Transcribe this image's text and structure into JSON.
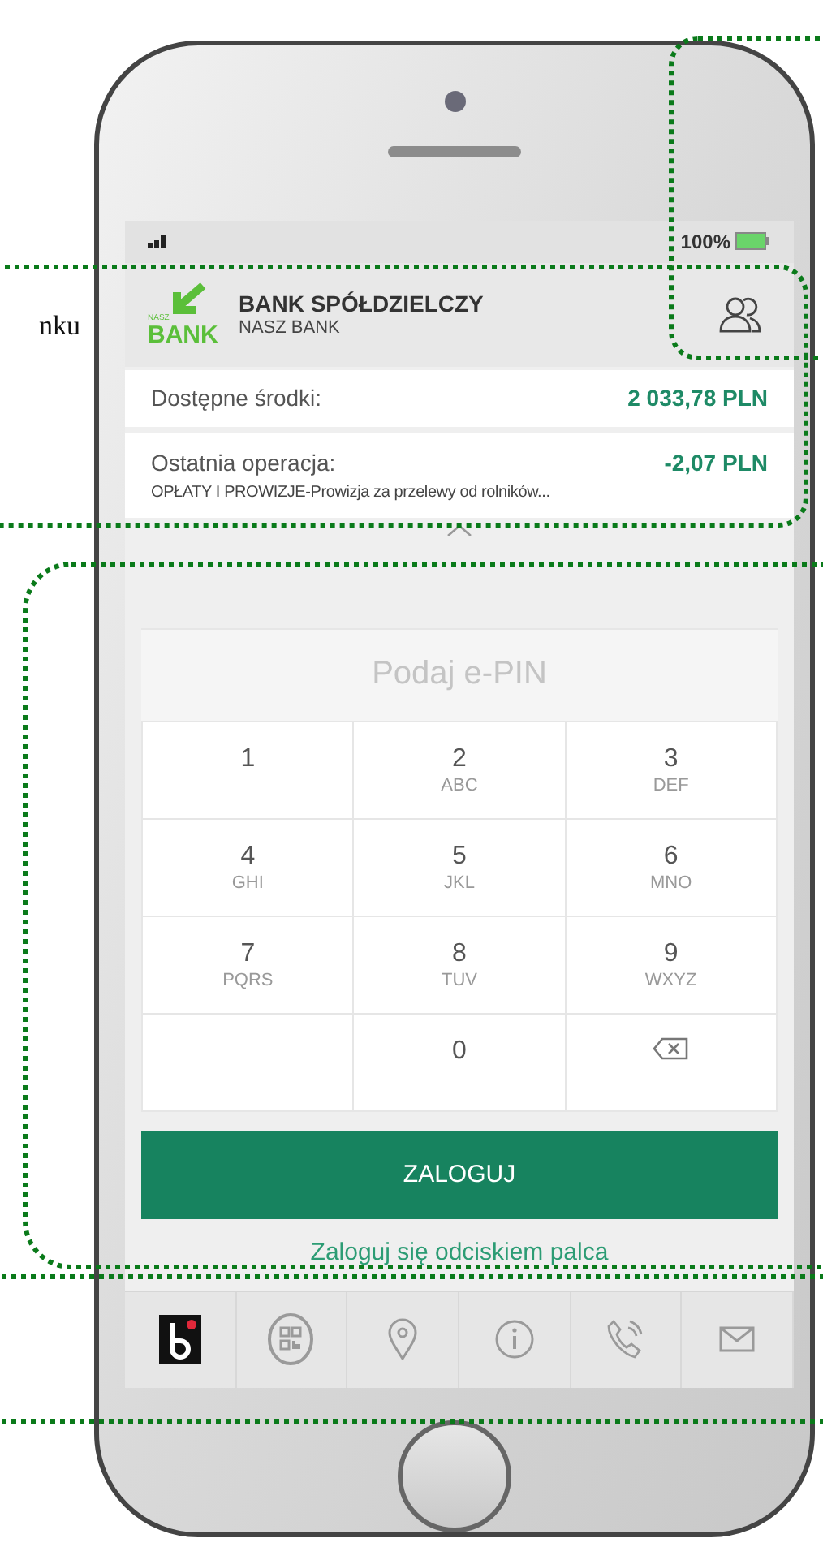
{
  "annotation": {
    "text": "nku"
  },
  "status_bar": {
    "battery": "100%"
  },
  "header": {
    "logo_small": "NASZ",
    "logo": "BANK",
    "title": "BANK SPÓŁDZIELCZY",
    "subtitle": "NASZ BANK"
  },
  "balance": {
    "label": "Dostępne środki:",
    "value": "2 033,78 PLN"
  },
  "last_operation": {
    "label": "Ostatnia operacja:",
    "value": "-2,07 PLN",
    "description": "OPŁATY I PROWIZJE-Prowizja za przelewy od rolników..."
  },
  "pin_field": {
    "placeholder": "Podaj e-PIN"
  },
  "keypad": [
    {
      "kind": "digit",
      "digit": "1"
    },
    {
      "kind": "digit",
      "digit": "2",
      "letters": "ABC"
    },
    {
      "kind": "digit",
      "digit": "3",
      "letters": "DEF"
    },
    {
      "kind": "digit",
      "digit": "4",
      "letters": "GHI"
    },
    {
      "kind": "digit",
      "digit": "5",
      "letters": "JKL"
    },
    {
      "kind": "digit",
      "digit": "6",
      "letters": "MNO"
    },
    {
      "kind": "digit",
      "digit": "7",
      "letters": "PQRS"
    },
    {
      "kind": "digit",
      "digit": "8",
      "letters": "TUV"
    },
    {
      "kind": "digit",
      "digit": "9",
      "letters": "WXYZ"
    },
    {
      "kind": "empty"
    },
    {
      "kind": "digit",
      "digit": "0"
    },
    {
      "kind": "backspace"
    }
  ],
  "login_button": "ZALOGUJ",
  "fingerprint_link": "Zaloguj się odciskiem palca",
  "bottom_nav": [
    {
      "kind": "app"
    },
    {
      "kind": "qr"
    },
    {
      "kind": "pin"
    },
    {
      "kind": "info"
    },
    {
      "kind": "phone"
    },
    {
      "kind": "mail"
    }
  ]
}
